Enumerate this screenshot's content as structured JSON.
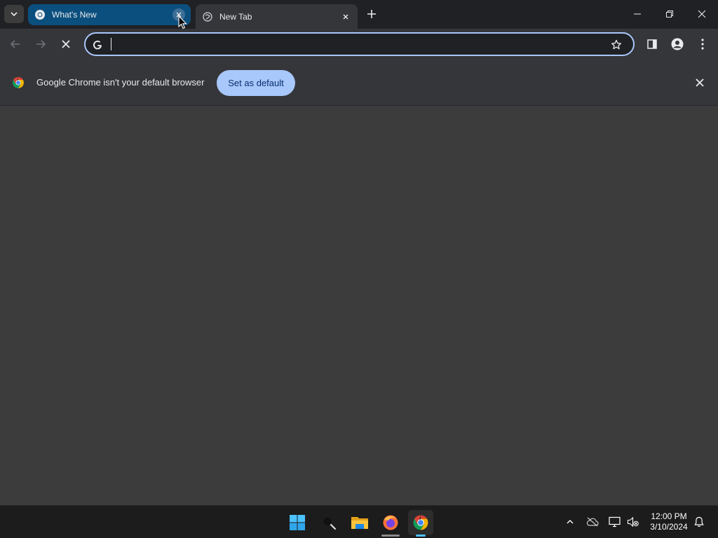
{
  "tabs": [
    {
      "title": "What's New",
      "active": true
    },
    {
      "title": "New Tab",
      "active": false
    }
  ],
  "omnibox": {
    "value": "",
    "placeholder": ""
  },
  "infobar": {
    "message": "Google Chrome isn't your default browser",
    "button_label": "Set as default"
  },
  "taskbar": {
    "time": "12:00 PM",
    "date": "3/10/2024",
    "apps": [
      "windows-start",
      "search",
      "file-explorer",
      "firefox",
      "chrome"
    ]
  },
  "colors": {
    "accent": "#a8c7fa",
    "active_tab": "#0b4f7e",
    "tab_strip": "#202124",
    "toolbar": "#35363a",
    "page_bg": "#3c3c3c"
  }
}
